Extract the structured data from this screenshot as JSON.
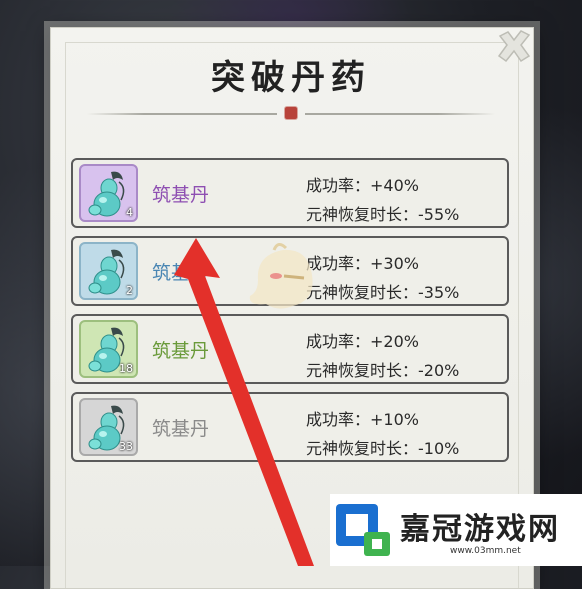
{
  "title": "突破丹药",
  "items": [
    {
      "name": "筑基丹",
      "count": "4",
      "stat1": "成功率：+40%",
      "stat2": "元神恢复时长：-55%",
      "name_color": "#8e4fb2",
      "icon_bg": "#d8c2ee",
      "icon_border": "#a98ac7"
    },
    {
      "name": "筑基丹",
      "count": "2",
      "stat1": "成功率：+30%",
      "stat2": "元神恢复时长：-35%",
      "name_color": "#4a86b3",
      "icon_bg": "#bfdbe8",
      "icon_border": "#8cb4c8"
    },
    {
      "name": "筑基丹",
      "count": "18",
      "stat1": "成功率：+20%",
      "stat2": "元神恢复时长：-20%",
      "name_color": "#6a9a3a",
      "icon_bg": "#cfe6b4",
      "icon_border": "#9dbf7e"
    },
    {
      "name": "筑基丹",
      "count": "33",
      "stat1": "成功率：+10%",
      "stat2": "元神恢复时长：-10%",
      "name_color": "#8a8a8a",
      "icon_bg": "#d6d6d6",
      "icon_border": "#a9a9a9"
    }
  ],
  "icons": {
    "close": "close-icon",
    "pill": "gourd-pill-icon"
  },
  "logo": {
    "text": "嘉冠游戏网",
    "url": "www.03mm.net"
  },
  "colors": {
    "arrow": "#e3302a"
  }
}
